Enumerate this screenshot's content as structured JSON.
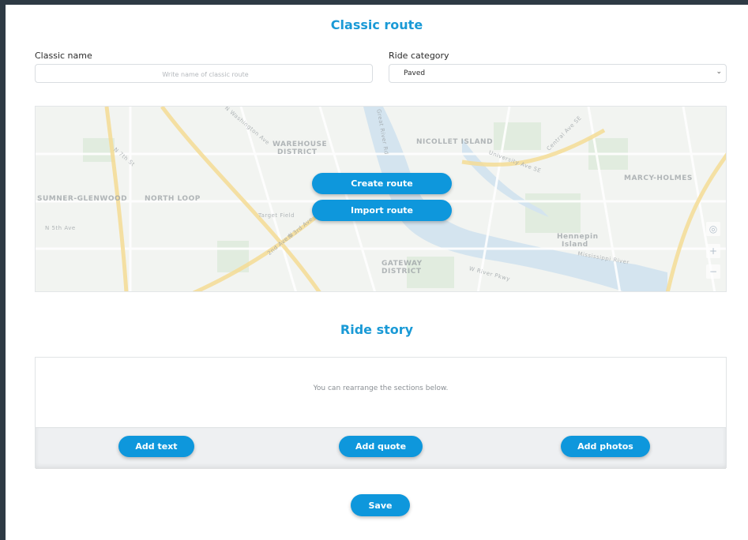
{
  "header": {
    "title": "Classic route"
  },
  "form": {
    "name_label": "Classic name",
    "name_placeholder": "Write name of classic route",
    "name_value": "",
    "category_label": "Ride category",
    "category_value": "Paved"
  },
  "map": {
    "create_route_label": "Create route",
    "import_route_label": "Import route",
    "areas": [
      "WAREHOUSE",
      "DISTRICT",
      "NICOLLET ISLAND",
      "MARCY-HOLMES",
      "SUMNER-GLENWOOD",
      "NORTH LOOP",
      "GATEWAY",
      "DISTRICT",
      "Hennepin",
      "Island",
      "Target Field"
    ],
    "streets": [
      "N Washington Ave",
      "N 7th St",
      "N 3rd Ave",
      "University Ave SE",
      "Central Ave SE",
      "Great River Rd",
      "Mississippi River",
      "N 5th Ave",
      "2nd Ave N",
      "W River Pkwy"
    ]
  },
  "story": {
    "title": "Ride story",
    "hint": "You can rearrange the sections below.",
    "add_text_label": "Add text",
    "add_quote_label": "Add quote",
    "add_photos_label": "Add photos"
  },
  "footer": {
    "save_label": "Save"
  },
  "colors": {
    "accent": "#0e97dc",
    "title": "#1a9ad6",
    "water": "#cfe0ee",
    "highway": "#f3d98a"
  }
}
